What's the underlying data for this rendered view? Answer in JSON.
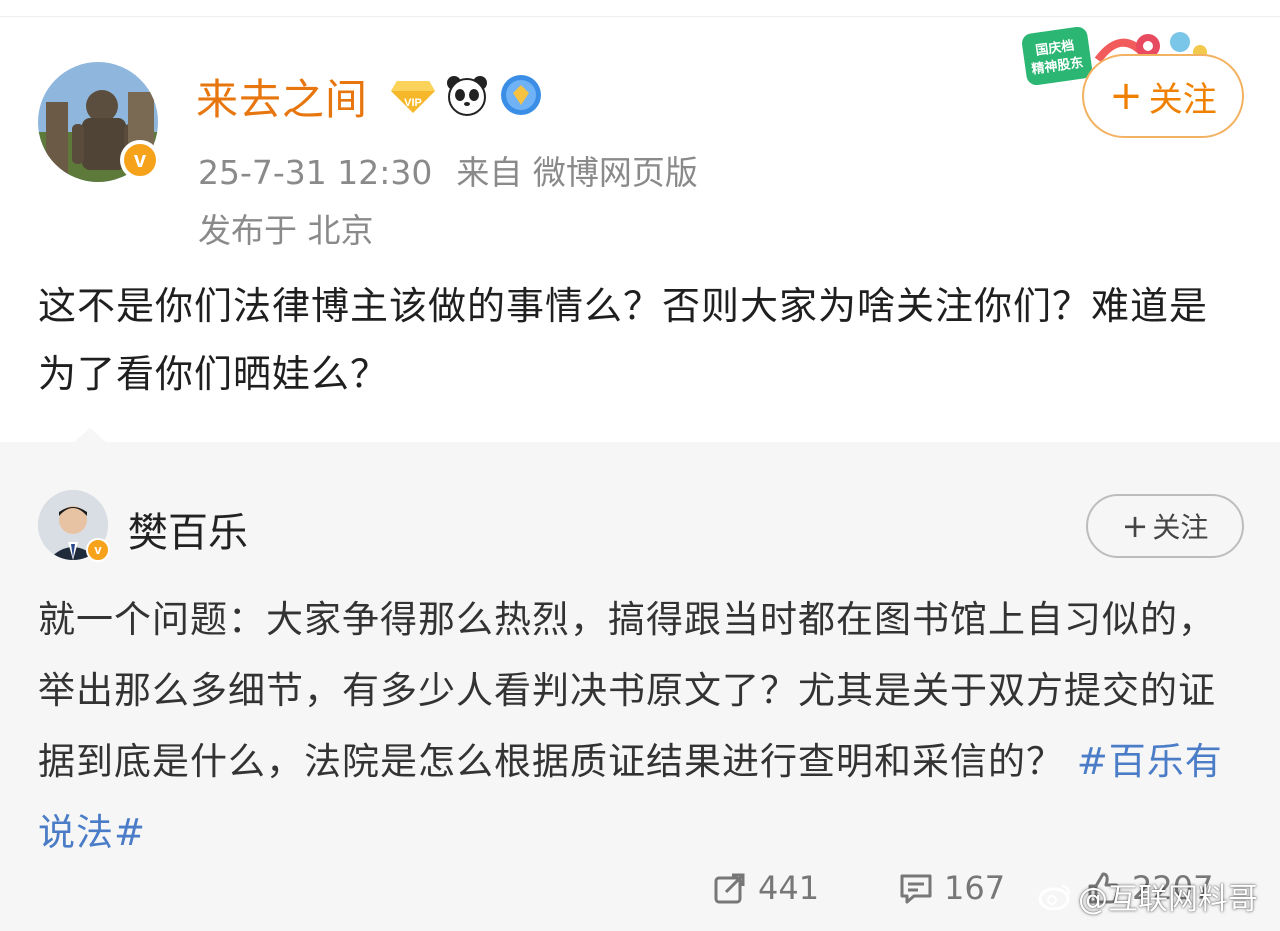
{
  "post": {
    "username": "来去之间",
    "timestamp": "25-7-31 12:30",
    "source": "来自 微博网页版",
    "location": "发布于 北京",
    "follow_label": "关注",
    "text": "这不是你们法律博主该做的事情么？否则大家为啥关注你们？难道是为了看你们晒娃么？",
    "badge_icons": [
      "vip-icon",
      "panda-icon",
      "verified-shield-icon"
    ],
    "festival_badge": "国庆档 精神股东"
  },
  "repost": {
    "username": "樊百乐",
    "follow_label": "关注",
    "text": "就一个问题：大家争得那么热烈，搞得跟当时都在图书馆上自习似的，举出那么多细节，有多少人看判决书原文了？尤其是关于双方提交的证据到底是什么，法院是怎么根据质证结果进行查明和采信的？ ",
    "hashtag": "#百乐有说法#",
    "counts": {
      "reposts": "441",
      "comments": "167",
      "likes": "2207"
    }
  },
  "watermark": "@互联网料哥",
  "colors": {
    "username": "#e8760e",
    "follow": "#f08100",
    "hashtag": "#4a7cc7",
    "meta": "#8a8a8a",
    "repost_bg": "#f6f6f6"
  }
}
